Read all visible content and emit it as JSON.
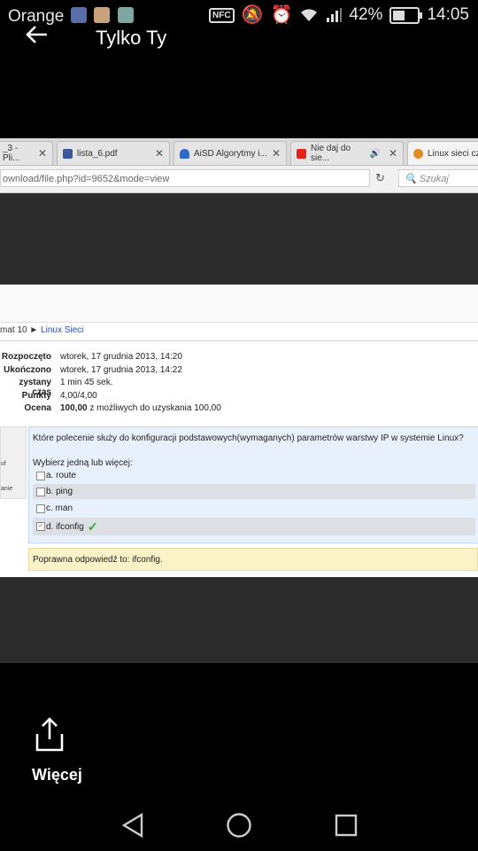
{
  "status": {
    "carrier": "Orange",
    "nfc": "NFC",
    "battery": "42%",
    "time": "14:05",
    "icons": [
      "app-icon-1",
      "avatar-icon",
      "gallery-icon",
      "nfc-icon",
      "mute-icon",
      "alarm-icon",
      "wifi-icon",
      "signal-icon",
      "battery-icon"
    ]
  },
  "header": {
    "title": "Tylko Ty"
  },
  "browser": {
    "tabs": [
      {
        "label": "_3 - Pli...",
        "icon": "document-icon"
      },
      {
        "label": "lista_6.pdf",
        "icon": "facebook-icon"
      },
      {
        "label": "AiSD Algorytmy i...",
        "icon": "cloud-icon"
      },
      {
        "label": "Nie daj do sie...",
        "icon": "youtube-icon"
      },
      {
        "label": "Linux sieci cz",
        "icon": "moodle-icon"
      }
    ],
    "url": "ownload/file.php?id=9652&mode=view",
    "search_placeholder": "Szukaj"
  },
  "page": {
    "breadcrumb_prefix": "mat 10 ►",
    "breadcrumb_link": "Linux Sieci",
    "summary": [
      {
        "k": "Rozpoczęto",
        "v": "wtorek, 17 grudnia 2013, 14:20"
      },
      {
        "k": "Ukończono",
        "v": "wtorek, 17 grudnia 2013, 14:22"
      },
      {
        "k": "zystany czas",
        "v": "1 min 45 sek."
      },
      {
        "k": "Punkty",
        "v": "4,00/4,00"
      },
      {
        "k": "Ocena",
        "v_bold": "100,00",
        "v": "z możliwych do uzyskania 100,00"
      }
    ],
    "side_labels": [
      "of",
      "anie"
    ],
    "question": "Które polecenie służy do konfiguracji podstawowych(wymaganych) parametrów warstwy IP w systemie Linux?",
    "prompt": "Wybierz jedną lub więcej:",
    "options": [
      {
        "label": "a. route",
        "checked": false,
        "correct": false
      },
      {
        "label": "b. ping",
        "checked": false,
        "correct": false
      },
      {
        "label": "c. man",
        "checked": false,
        "correct": false
      },
      {
        "label": "d. ifconfig",
        "checked": true,
        "correct": true
      }
    ],
    "feedback": "Poprawna odpowiedź to: ifconfig."
  },
  "share": {
    "label": "Więcej"
  },
  "colors": {
    "link": "#2a4eb3",
    "question_bg": "#e8f1fb",
    "feedback_bg": "#fbf2c7",
    "correct_tick": "#22b222"
  }
}
